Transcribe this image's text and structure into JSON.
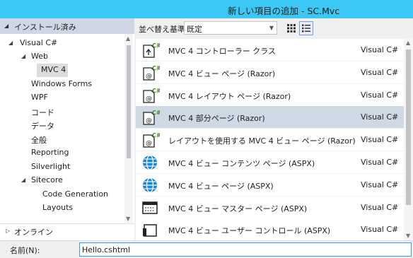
{
  "window": {
    "title": "新しい項目の追加 - SC.Mvc"
  },
  "left_panel": {
    "header": "インストール済み",
    "tree": [
      {
        "label": "Visual C#",
        "expander": "◢"
      },
      {
        "label": "Web",
        "expander": "◢"
      },
      {
        "label": "MVC 4",
        "expander": ""
      },
      {
        "label": "Windows Forms",
        "expander": ""
      },
      {
        "label": "WPF",
        "expander": ""
      },
      {
        "label": "コード",
        "expander": ""
      },
      {
        "label": "データ",
        "expander": ""
      },
      {
        "label": "全般",
        "expander": ""
      },
      {
        "label": "Reporting",
        "expander": ""
      },
      {
        "label": "Silverlight",
        "expander": ""
      },
      {
        "label": "Sitecore",
        "expander": "◢"
      },
      {
        "label": "Code Generation",
        "expander": ""
      },
      {
        "label": "Layouts",
        "expander": ""
      }
    ],
    "online": "オンライン",
    "selected_index": 2
  },
  "sort": {
    "label": "並べ替え基準:",
    "value": "既定"
  },
  "items": [
    {
      "name": "MVC 4 コントローラー クラス",
      "type": "Visual C#",
      "icon": "cs-controller-icon"
    },
    {
      "name": "MVC 4 ビュー ページ (Razor)",
      "type": "Visual C#",
      "icon": "cs-razor-page-icon"
    },
    {
      "name": "MVC 4 レイアウト ページ (Razor)",
      "type": "Visual C#",
      "icon": "cs-razor-page-icon"
    },
    {
      "name": "MVC 4 部分ページ (Razor)",
      "type": "Visual C#",
      "icon": "cs-razor-page-icon"
    },
    {
      "name": "レイアウトを使用する MVC 4 ビュー ページ (Razor)",
      "type": "Visual C#",
      "icon": "cs-razor-page-icon"
    },
    {
      "name": "MVC 4 ビュー コンテンツ ページ (ASPX)",
      "type": "Visual C#",
      "icon": "globe-icon"
    },
    {
      "name": "MVC 4 ビュー ページ (ASPX)",
      "type": "Visual C#",
      "icon": "globe-icon"
    },
    {
      "name": "MVC 4 ビュー マスター ページ (ASPX)",
      "type": "Visual C#",
      "icon": "master-page-icon"
    },
    {
      "name": "MVC 4 ビュー ユーザー コントロール (ASPX)",
      "type": "Visual C#",
      "icon": "user-control-icon"
    }
  ],
  "selected_item_index": 3,
  "name_field": {
    "label": "名前(N):",
    "value": "Hello.cshtml"
  },
  "colors": {
    "title_bg": "#3cc8f4",
    "selected_row": "#cfd8e5",
    "globe": "#1e88d6",
    "cs_green": "#3c8a1e"
  }
}
